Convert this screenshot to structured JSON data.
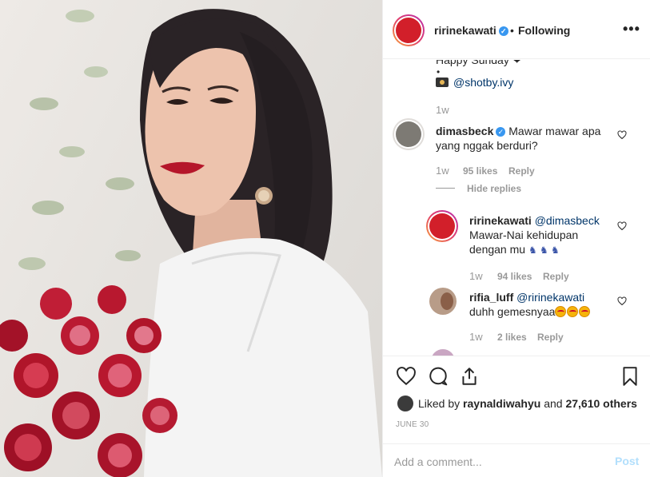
{
  "header": {
    "username": "ririnekawati",
    "verified_icon": "verified-badge-icon",
    "separator": "•",
    "follow_status": "Following",
    "more_icon": "more-options-icon",
    "more_label": "•••"
  },
  "caption": {
    "cut_text": "Happy Sunday ❤",
    "bullet": "•",
    "camera_icon": "camera-icon",
    "credit": "@shotby.ivy",
    "time": "1w"
  },
  "comments": [
    {
      "username": "dimasbeck",
      "verified": true,
      "text_line1": "Mawar mawar apa",
      "text_line2": "yang nggak berduri?",
      "time": "1w",
      "likes": "95 likes",
      "reply": "Reply",
      "hide_replies": "Hide replies",
      "replies": [
        {
          "username": "ririnekawati",
          "mention": "@dimasbeck",
          "text_line1": "Mawar-Nai kehidupan",
          "text_line2": "dengan mu",
          "emojis": "🕺🕺🕺",
          "time": "1w",
          "likes": "94 likes",
          "reply": "Reply"
        },
        {
          "username": "rifia_luff",
          "mention": "@ririnekawati",
          "text_line1": "duhh gemesnyaa",
          "emojis": "🤩🤩🤩",
          "time": "1w",
          "likes": "2 likes",
          "reply": "Reply"
        }
      ]
    }
  ],
  "actions": {
    "like_icon": "heart-icon",
    "comment_icon": "comment-icon",
    "share_icon": "share-icon",
    "save_icon": "bookmark-icon",
    "liked_by_prefix": "Liked by",
    "liked_by_user": "raynaldiwahyu",
    "liked_by_and": "and",
    "liked_by_count": "27,610 others",
    "date": "JUNE 30"
  },
  "add_comment": {
    "placeholder": "Add a comment...",
    "post_label": "Post"
  },
  "colors": {
    "accent_link": "#003569",
    "verified": "#3897f0",
    "post_disabled": "#b2dffc",
    "muted": "#999999",
    "avatar_red": "#d21f2a"
  }
}
